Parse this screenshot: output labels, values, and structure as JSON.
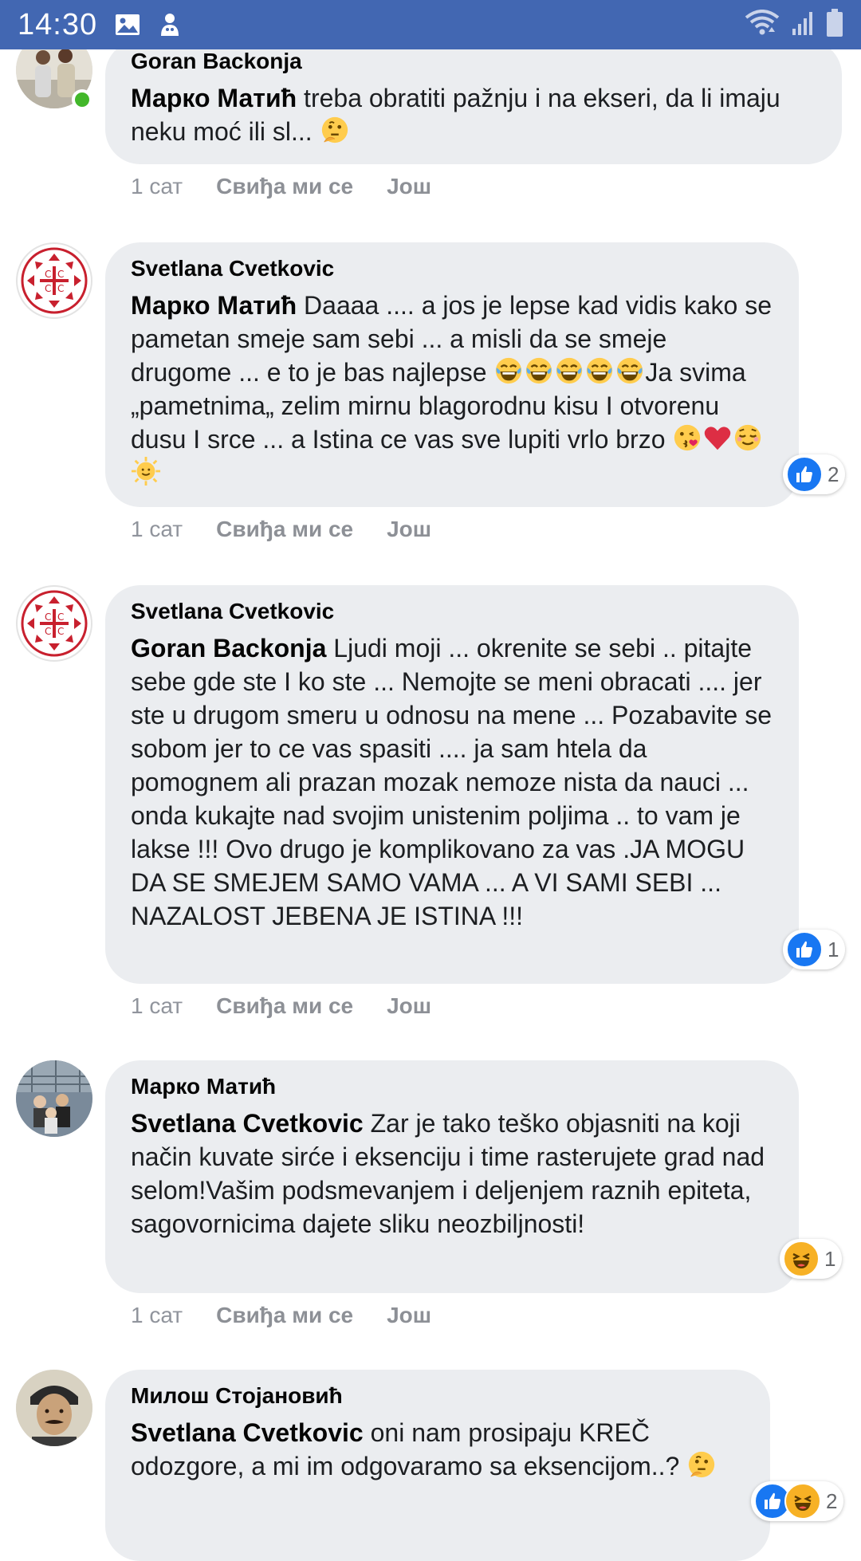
{
  "status_bar": {
    "time": "14:30",
    "icons": [
      "gallery-icon",
      "notification-icon",
      "wifi-icon",
      "signal-icon",
      "battery-icon"
    ]
  },
  "colors": {
    "brand_blue": "#4267b2",
    "bubble_bg": "#ebedf0",
    "online_green": "#42b72a",
    "like_blue": "#1877f2",
    "haha_yellow": "#f7b125"
  },
  "comments": [
    {
      "author": "Goran Backonja",
      "mention": "Марко Матић",
      "text": " treba obratiti pažnju i na ekseri, da li imaju neku moć ili sl... ",
      "emojis_after": [
        "thinking"
      ],
      "time": "1 сат",
      "like_label": "Свиђа ми се",
      "more_label": "Још",
      "online": true,
      "reactions": null
    },
    {
      "author": "Svetlana Cvetkovic",
      "mention": "Марко Матић",
      "text": " Daaaa .... a jos je lepse kad vidis kako se pametan smeje sam sebi ... a misli da se smeje drugome ... e to je bas najlepse ",
      "text2": "Ja svima „pametnima„ zelim mirnu blagorodnu kisu I otvorenu dusu I srce ... a Istina ce vas sve lupiti vrlo brzo ",
      "time": "1 сат",
      "like_label": "Свиђа ми се",
      "more_label": "Још",
      "reactions": {
        "types": [
          "like"
        ],
        "count": "2"
      }
    },
    {
      "author": "Svetlana Cvetkovic",
      "mention": "Goran Backonja",
      "text": " Ljudi moji ... okrenite se sebi .. pitajte sebe gde ste I ko ste ... Nemojte se meni obracati .... jer ste u drugom smeru u odnosu na mene ... Pozabavite se sobom jer to ce vas spasiti .... ja sam htela da pomognem ali prazan mozak nemoze nista da nauci ... onda kukajte nad svojim unistenim poljima .. to vam je lakse !!! Ovo drugo je komplikovano za vas .JA MOGU DA SE SMEJEM SAMO VAMA ... A VI SAMI SEBI ... NAZALOST JEBENA JE ISTINA !!!",
      "time": "1 сат",
      "like_label": "Свиђа ми се",
      "more_label": "Још",
      "reactions": {
        "types": [
          "like"
        ],
        "count": "1"
      }
    },
    {
      "author": "Марко Матић",
      "mention": "Svetlana Cvetkovic",
      "text": " Zar je tako teško objasniti na koji način kuvate sirće i eksenciju i time rasterujete grad nad selom!Vašim podsmevanjem i deljenjem raznih epiteta, sagovornicima dajete sliku neozbiljnosti!",
      "time": "1 сат",
      "like_label": "Свиђа ми се",
      "more_label": "Још",
      "reactions": {
        "types": [
          "haha"
        ],
        "count": "1"
      }
    },
    {
      "author": "Милош Стојановић",
      "mention": "Svetlana Cvetkovic",
      "text": " oni nam prosipaju KREČ odozgore, a mi im odgovaramo sa eksencijom..? ",
      "time": "",
      "reactions": {
        "types": [
          "like",
          "haha"
        ],
        "count": "2"
      }
    }
  ]
}
